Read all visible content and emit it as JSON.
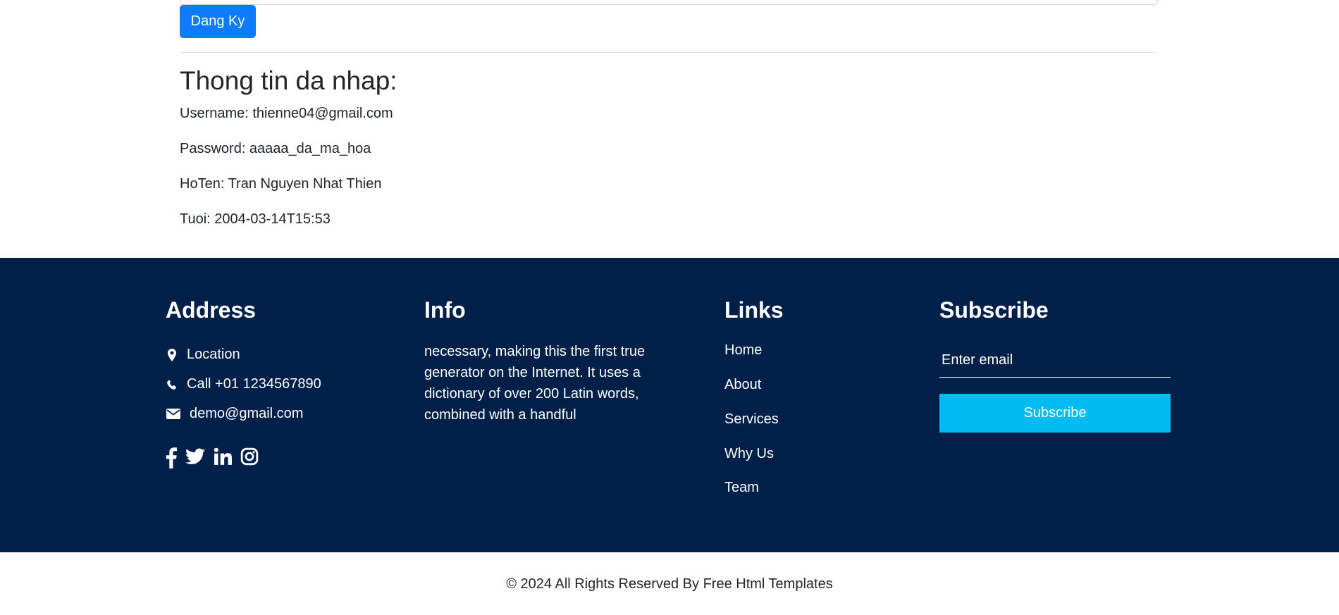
{
  "form": {
    "register_label": "Dang Ky"
  },
  "info": {
    "title": "Thong tin da nhap:",
    "username": "Username: thienne04@gmail.com",
    "password": "Password: aaaaa_da_ma_hoa",
    "hoten": "HoTen: Tran Nguyen Nhat Thien",
    "tuoi": "Tuoi: 2004-03-14T15:53"
  },
  "footer": {
    "address": {
      "heading": "Address",
      "location": "Location",
      "phone": "Call +01 1234567890",
      "email": "demo@gmail.com",
      "social_icons": [
        "facebook-icon",
        "twitter-icon",
        "linkedin-icon",
        "instagram-icon"
      ]
    },
    "info": {
      "heading": "Info",
      "text": "necessary, making this the first true generator on the Internet. It uses a dictionary of over 200 Latin words, combined with a handful"
    },
    "links": {
      "heading": "Links",
      "items": [
        "Home",
        "About",
        "Services",
        "Why Us",
        "Team"
      ]
    },
    "subscribe": {
      "heading": "Subscribe",
      "placeholder": "Enter email",
      "button_label": "Subscribe"
    },
    "background_color": "#00204a",
    "accent_color": "#00bbf0"
  },
  "copyright": "© 2024 All Rights Reserved By Free Html Templates",
  "colors": {
    "primary_button": "#0d7bfb"
  }
}
